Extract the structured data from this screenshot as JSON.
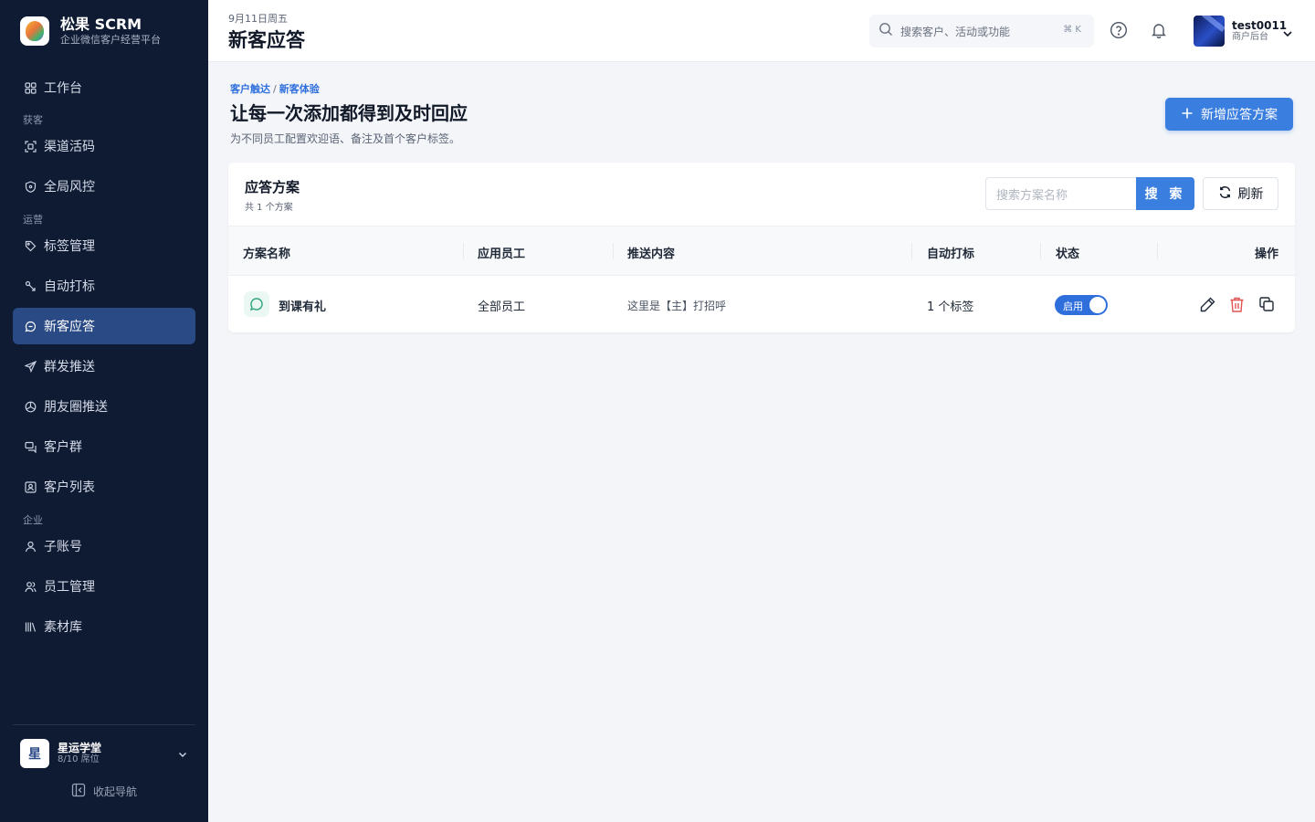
{
  "brand": {
    "name": "松果 SCRM",
    "subtitle": "企业微信客户经营平台"
  },
  "sidebar": {
    "items": [
      {
        "label": "工作台",
        "icon": "grid-icon"
      },
      {
        "section": "获客"
      },
      {
        "label": "渠道活码",
        "icon": "qrcode-scan-icon"
      },
      {
        "label": "全局风控",
        "icon": "shield-icon"
      },
      {
        "section": "运营"
      },
      {
        "label": "标签管理",
        "icon": "tag-icon"
      },
      {
        "label": "自动打标",
        "icon": "auto-tag-icon"
      },
      {
        "label": "新客应答",
        "icon": "chat-icon",
        "active": true
      },
      {
        "label": "群发推送",
        "icon": "send-icon"
      },
      {
        "label": "朋友圈推送",
        "icon": "aperture-icon"
      },
      {
        "label": "客户群",
        "icon": "group-chat-icon"
      },
      {
        "label": "客户列表",
        "icon": "contact-card-icon"
      },
      {
        "section": "企业"
      },
      {
        "label": "子账号",
        "icon": "user-icon"
      },
      {
        "label": "员工管理",
        "icon": "users-icon"
      },
      {
        "label": "素材库",
        "icon": "library-icon"
      }
    ],
    "sections": {
      "acquire": "获客",
      "operate": "运营",
      "enterprise": "企业"
    },
    "labels": {
      "workbench": "工作台",
      "channel_code": "渠道活码",
      "risk_control": "全局风控",
      "tag_manage": "标签管理",
      "auto_tag": "自动打标",
      "new_reply": "新客应答",
      "mass_push": "群发推送",
      "moments_push": "朋友圈推送",
      "customer_group": "客户群",
      "customer_list": "客户列表",
      "sub_account": "子账号",
      "staff_manage": "员工管理",
      "material_lib": "素材库"
    },
    "org": {
      "avatar_char": "星",
      "name": "星运学堂",
      "seats": "8/10 席位"
    },
    "collapse_label": "收起导航"
  },
  "header": {
    "date": "9月11日周五",
    "title": "新客应答",
    "search_placeholder": "搜索客户、活动或功能",
    "search_shortcut": "⌘ K",
    "user": {
      "name": "test0011",
      "role": "商户后台"
    }
  },
  "main": {
    "breadcrumb": [
      "客户触达",
      "新客体验"
    ],
    "breadcrumb_sep": "/",
    "heading": "让每一次添加都得到及时回应",
    "description": "为不同员工配置欢迎语、备注及首个客户标签。",
    "add_button": "新增应答方案"
  },
  "card": {
    "title": "应答方案",
    "count": "共 1 个方案",
    "search_placeholder": "搜索方案名称",
    "search_button": "搜 索",
    "refresh_button": "刷新",
    "columns": [
      "方案名称",
      "应用员工",
      "推送内容",
      "自动打标",
      "状态",
      "操作"
    ],
    "rows": [
      {
        "name": "到课有礼",
        "staff": "全部员工",
        "content": "这里是【主】打招呼",
        "tags": "1 个标签",
        "status": "启用",
        "enabled": true
      }
    ]
  },
  "colors": {
    "sidebar_bg": "#0f1b33",
    "active_bg": "#2a4a86",
    "accent": "#3a7ee0",
    "danger": "#e05252"
  }
}
